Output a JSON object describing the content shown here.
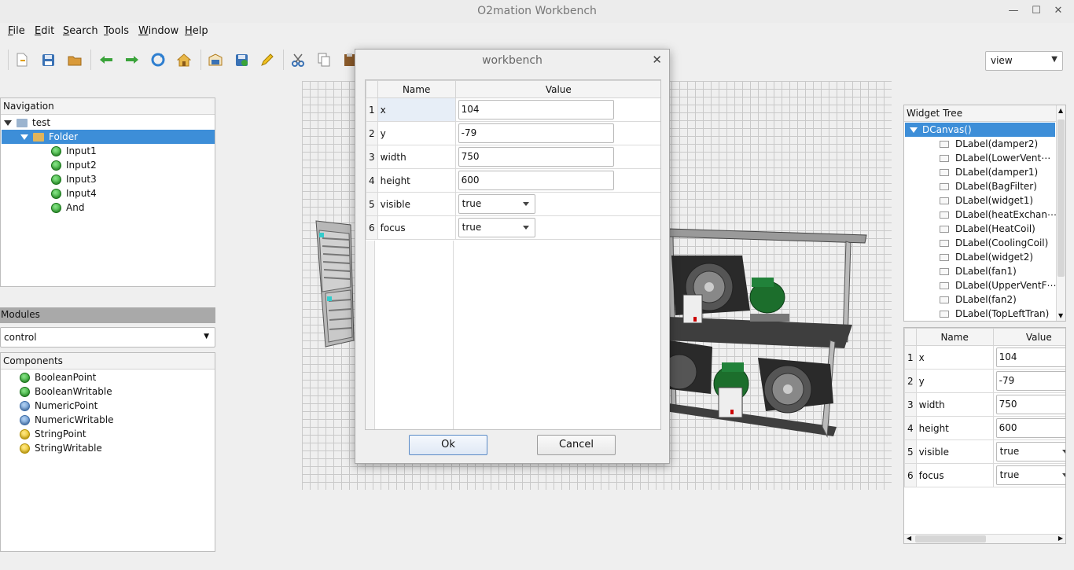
{
  "window": {
    "title": "O2mation Workbench"
  },
  "menubar": {
    "items": [
      "File",
      "Edit",
      "Search",
      "Tools",
      "Window",
      "Help"
    ]
  },
  "toolbar": {
    "icons": [
      "new-file-icon",
      "save-icon",
      "open-folder-icon",
      "back-arrow-icon",
      "forward-arrow-icon",
      "refresh-icon",
      "home-icon",
      "archive-icon",
      "save-as-icon",
      "pencil-icon",
      "cut-icon",
      "copy-icon",
      "paste-icon"
    ],
    "view_mode": "view"
  },
  "navigation": {
    "title": "Navigation",
    "root": "test",
    "folder": "Folder",
    "items": [
      "Input1",
      "Input2",
      "Input3",
      "Input4",
      "And"
    ]
  },
  "modules": {
    "title": "Modules",
    "selected": "control"
  },
  "components": {
    "title": "Components",
    "items": [
      {
        "label": "BooleanPoint",
        "color": "green"
      },
      {
        "label": "BooleanWritable",
        "color": "green"
      },
      {
        "label": "NumericPoint",
        "color": "blue"
      },
      {
        "label": "NumericWritable",
        "color": "blue"
      },
      {
        "label": "StringPoint",
        "color": "yellow"
      },
      {
        "label": "StringWritable",
        "color": "yellow"
      }
    ]
  },
  "widget_tree": {
    "title": "Widget Tree",
    "root": "DCanvas()",
    "items": [
      "DLabel(damper2)",
      "DLabel(LowerVent⋯",
      "DLabel(damper1)",
      "DLabel(BagFilter)",
      "DLabel(widget1)",
      "DLabel(heatExchan⋯",
      "DLabel(HeatCoil)",
      "DLabel(CoolingCoil)",
      "DLabel(widget2)",
      "DLabel(fan1)",
      "DLabel(UpperVentF⋯",
      "DLabel(fan2)",
      "DLabel(TopLeftTran)"
    ]
  },
  "properties": {
    "headers": {
      "name": "Name",
      "value": "Value"
    },
    "rows": [
      {
        "num": "1",
        "name": "x",
        "value": "104",
        "type": "text"
      },
      {
        "num": "2",
        "name": "y",
        "value": "-79",
        "type": "text"
      },
      {
        "num": "3",
        "name": "width",
        "value": "750",
        "type": "text"
      },
      {
        "num": "4",
        "name": "height",
        "value": "600",
        "type": "text"
      },
      {
        "num": "5",
        "name": "visible",
        "value": "true",
        "type": "combo"
      },
      {
        "num": "6",
        "name": "focus",
        "value": "true",
        "type": "combo"
      }
    ]
  },
  "dialog": {
    "title": "workbench",
    "ok_label": "Ok",
    "cancel_label": "Cancel"
  },
  "colors": {
    "selection": "#3d8ed8",
    "canvas_grid": "#c9c9c9"
  }
}
